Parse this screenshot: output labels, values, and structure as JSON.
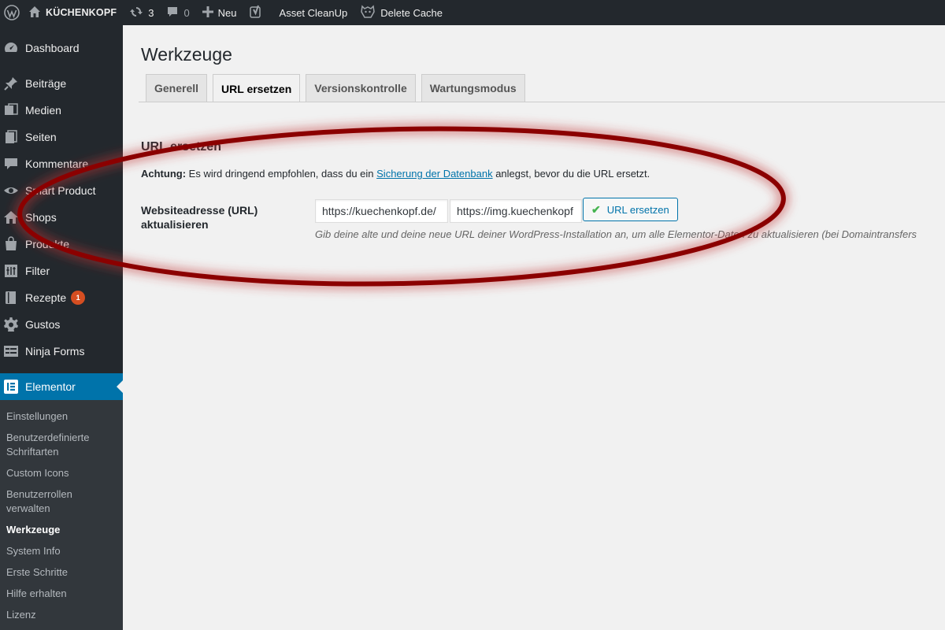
{
  "adminbar": {
    "site_name": "KÜCHENKOPF",
    "updates_count": "3",
    "comments_count": "0",
    "new_label": "Neu",
    "asset_cleanup_label": "Asset CleanUp",
    "delete_cache_label": "Delete Cache"
  },
  "sidebar": {
    "items": [
      {
        "label": "Dashboard",
        "icon": "dashboard-icon"
      },
      {
        "label": "Beiträge",
        "icon": "pin-icon"
      },
      {
        "label": "Medien",
        "icon": "media-icon"
      },
      {
        "label": "Seiten",
        "icon": "pages-icon"
      },
      {
        "label": "Kommentare",
        "icon": "comment-icon"
      },
      {
        "label": "Smart Product",
        "icon": "eye-icon"
      },
      {
        "label": "Shops",
        "icon": "home-icon"
      },
      {
        "label": "Produkte",
        "icon": "bag-icon"
      },
      {
        "label": "Filter",
        "icon": "filter-icon"
      },
      {
        "label": "Rezepte",
        "icon": "book-icon",
        "badge": "1"
      },
      {
        "label": "Gustos",
        "icon": "gear-icon"
      },
      {
        "label": "Ninja Forms",
        "icon": "forms-icon"
      }
    ],
    "active": {
      "label": "Elementor",
      "icon": "elementor-icon"
    },
    "submenu": [
      "Einstellungen",
      "Benutzerdefinierte Schriftarten",
      "Custom Icons",
      "Benutzerrollen verwalten",
      "Werkzeuge",
      "System Info",
      "Erste Schritte",
      "Hilfe erhalten",
      "Lizenz"
    ]
  },
  "main": {
    "title": "Werkzeuge",
    "tabs": [
      "Generell",
      "URL ersetzen",
      "Versionskontrolle",
      "Wartungsmodus"
    ],
    "active_tab": "URL ersetzen",
    "section_title": "URL ersetzen",
    "notice": {
      "strong": "Achtung:",
      "before_link": " Es wird dringend empfohlen, dass du ein ",
      "link": "Sicherung der Datenbank",
      "after_link": " anlegst, bevor du die URL ersetzt."
    },
    "field_label": "Websiteadresse (URL) aktualisieren",
    "old_url_value": "https://kuechenkopf.de/",
    "new_url_value": "https://img.kuechenkopf",
    "button_label": "URL ersetzen",
    "description": "Gib deine alte und deine neue URL deiner WordPress-Installation an, um alle Elementor-Daten zu aktualisieren (bei Domaintransfers"
  },
  "colors": {
    "admin_dark": "#23282d",
    "submenu_bg": "#32373c",
    "accent": "#0073aa",
    "badge": "#d54e21",
    "highlight": "#8b0000"
  }
}
